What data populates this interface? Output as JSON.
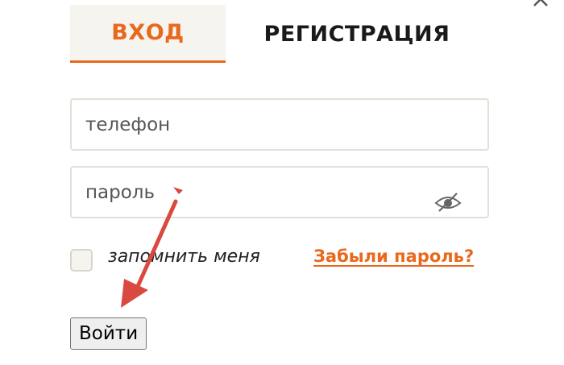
{
  "tabs": {
    "login_label": "ВХОД",
    "register_label": "РЕГИСТРАЦИЯ"
  },
  "form": {
    "phone_placeholder": "телефон",
    "password_placeholder": "пароль",
    "remember_label": "запомнить меня",
    "remember_checked": false,
    "forgot_label": "Забыли пароль?",
    "submit_label": "Войти"
  },
  "icons": {
    "close": "close-icon",
    "password_visibility": "eye-slash-icon",
    "annotation": "red-arrow-icon"
  },
  "colors": {
    "accent": "#e8691d",
    "active_tab_bg": "#f6f4ef",
    "field_border": "#e2e0d6",
    "arrow": "#d9493f"
  }
}
